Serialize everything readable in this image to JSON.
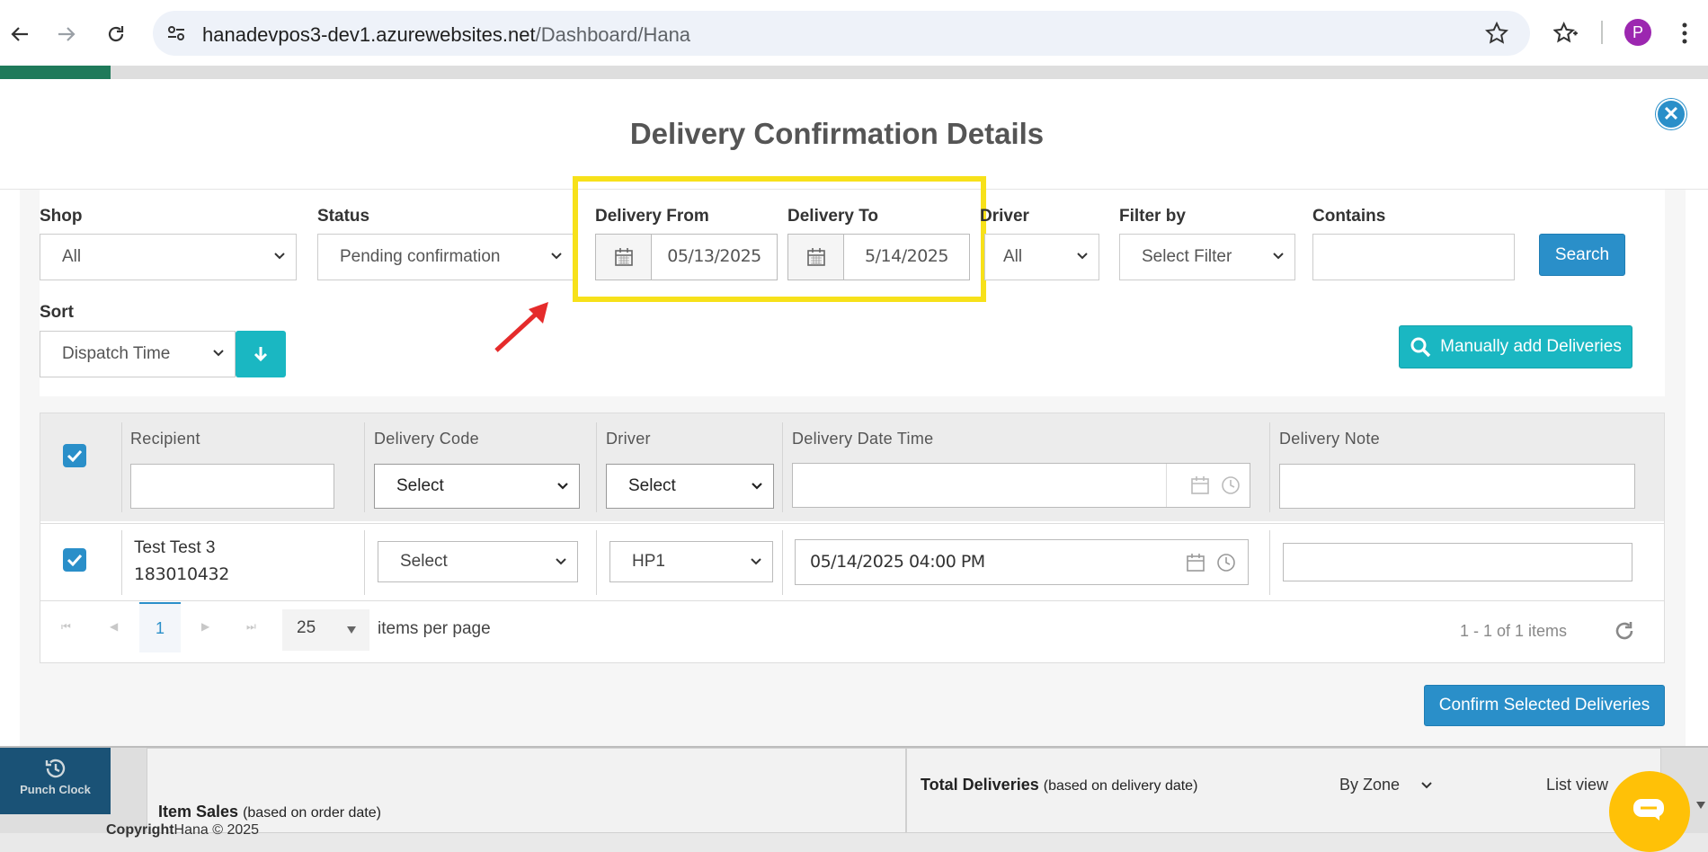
{
  "browser": {
    "url_host": "hanadevpos3-dev1.azurewebsites.net",
    "url_path": "/Dashboard/Hana",
    "profile_initial": "P"
  },
  "background_page": {
    "punch_clock_label": "Punch Clock",
    "item_sales_title": "Item Sales",
    "item_sales_note": "(based on order date)",
    "total_deliveries_title": "Total Deliveries",
    "total_deliveries_note": "(based on delivery date)",
    "by_zone_label": "By Zone",
    "list_view_label": "List view",
    "copyright_bold": "Copyright",
    "copyright_text": "Hana © 2025"
  },
  "modal": {
    "title": "Delivery Confirmation Details",
    "filters": {
      "shop_label": "Shop",
      "shop_value": "All",
      "status_label": "Status",
      "status_value": "Pending confirmation",
      "delivery_from_label": "Delivery From",
      "delivery_from_value": "05/13/2025",
      "delivery_to_label": "Delivery To",
      "delivery_to_value": "5/14/2025",
      "driver_label": "Driver",
      "driver_value": "All",
      "filter_by_label": "Filter by",
      "filter_by_value": "Select Filter",
      "contains_label": "Contains",
      "contains_value": "",
      "search_button": "Search",
      "sort_label": "Sort",
      "sort_value": "Dispatch Time",
      "manually_add_button": "Manually add Deliveries"
    },
    "grid": {
      "headers": {
        "recipient": "Recipient",
        "delivery_code": "Delivery Code",
        "driver": "Driver",
        "delivery_date_time": "Delivery Date Time",
        "delivery_note": "Delivery Note"
      },
      "filter_row": {
        "delivery_code": "Select",
        "driver": "Select"
      },
      "rows": [
        {
          "recipient_name": "Test Test 3",
          "recipient_phone": "183010432",
          "delivery_code": "Select",
          "driver": "HP1",
          "delivery_date_time": "05/14/2025 04:00 PM",
          "delivery_note": ""
        }
      ],
      "pager": {
        "current_page": "1",
        "page_size": "25",
        "items_per_page_label": "items per page",
        "summary": "1 - 1 of 1 items"
      }
    },
    "confirm_button": "Confirm Selected Deliveries"
  },
  "colors": {
    "primary_blue": "#2a8fc9",
    "teal": "#1ab7c2",
    "highlight_yellow": "#f7e11a",
    "arrow_red": "#e52b2b"
  }
}
